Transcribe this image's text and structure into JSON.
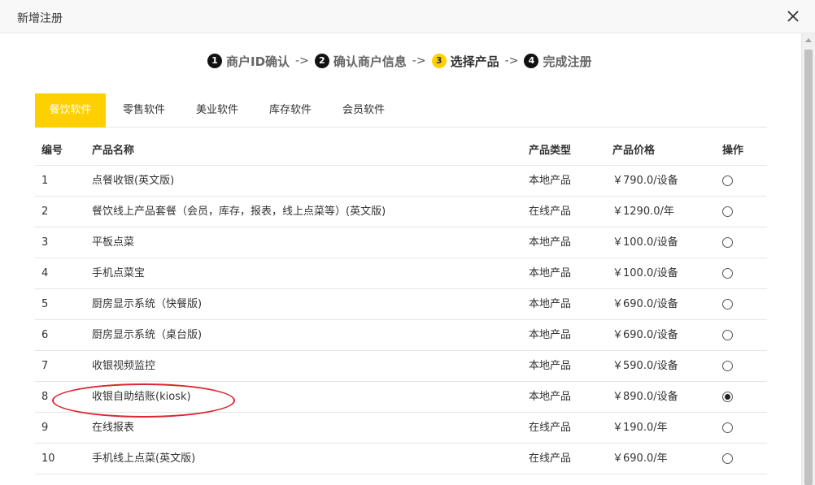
{
  "window": {
    "title": "新增注册"
  },
  "steps": [
    {
      "num": "1",
      "label": "商户ID确认"
    },
    {
      "num": "2",
      "label": "确认商户信息"
    },
    {
      "num": "3",
      "label": "选择产品"
    },
    {
      "num": "4",
      "label": "完成注册"
    }
  ],
  "step_arrow": "->",
  "tabs": [
    "餐饮软件",
    "零售软件",
    "美业软件",
    "库存软件",
    "会员软件"
  ],
  "active_tab": "餐饮软件",
  "table": {
    "headers": [
      "编号",
      "产品名称",
      "产品类型",
      "产品价格",
      "操作"
    ],
    "rows": [
      {
        "no": "1",
        "name": "点餐收银(英文版)",
        "type": "本地产品",
        "price": "￥790.0/设备",
        "selected": false
      },
      {
        "no": "2",
        "name": "餐饮线上产品套餐（会员，库存，报表，线上点菜等）(英文版)",
        "type": "在线产品",
        "price": "￥1290.0/年",
        "selected": false
      },
      {
        "no": "3",
        "name": "平板点菜",
        "type": "本地产品",
        "price": "￥100.0/设备",
        "selected": false
      },
      {
        "no": "4",
        "name": "手机点菜宝",
        "type": "本地产品",
        "price": "￥100.0/设备",
        "selected": false
      },
      {
        "no": "5",
        "name": "厨房显示系统（快餐版)",
        "type": "本地产品",
        "price": "￥690.0/设备",
        "selected": false
      },
      {
        "no": "6",
        "name": "厨房显示系统（桌台版)",
        "type": "本地产品",
        "price": "￥690.0/设备",
        "selected": false
      },
      {
        "no": "7",
        "name": "收银视频监控",
        "type": "本地产品",
        "price": "￥590.0/设备",
        "selected": false
      },
      {
        "no": "8",
        "name": "收银自助结账(kiosk)",
        "type": "本地产品",
        "price": "￥890.0/设备",
        "selected": true
      },
      {
        "no": "9",
        "name": "在线报表",
        "type": "在线产品",
        "price": "￥190.0/年",
        "selected": false
      },
      {
        "no": "10",
        "name": "手机线上点菜(英文版)",
        "type": "在线产品",
        "price": "￥690.0/年",
        "selected": false
      }
    ]
  },
  "colors": {
    "accent": "#ffd000",
    "annotation": "#d9282f",
    "step_inactive": "#111111"
  },
  "icons": {
    "close": "close-icon",
    "step_badge": "step-number-badge"
  }
}
